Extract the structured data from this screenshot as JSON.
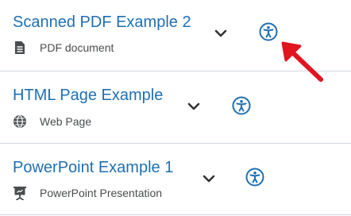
{
  "accent_color": "#1f6fb2",
  "arrow_color": "#e0151f",
  "items": [
    {
      "title": "Scanned PDF Example 2",
      "type_label": "PDF document",
      "type_icon": "document-icon",
      "accessibility_icon": "accessibility-icon",
      "expand_icon": "chevron-down-icon"
    },
    {
      "title": "HTML Page Example",
      "type_label": "Web Page",
      "type_icon": "globe-icon",
      "accessibility_icon": "accessibility-icon",
      "expand_icon": "chevron-down-icon"
    },
    {
      "title": "PowerPoint Example 1",
      "type_label": "PowerPoint Presentation",
      "type_icon": "presentation-icon",
      "accessibility_icon": "accessibility-icon",
      "expand_icon": "chevron-down-icon"
    }
  ],
  "annotation": {
    "icon": "red-arrow-icon"
  }
}
